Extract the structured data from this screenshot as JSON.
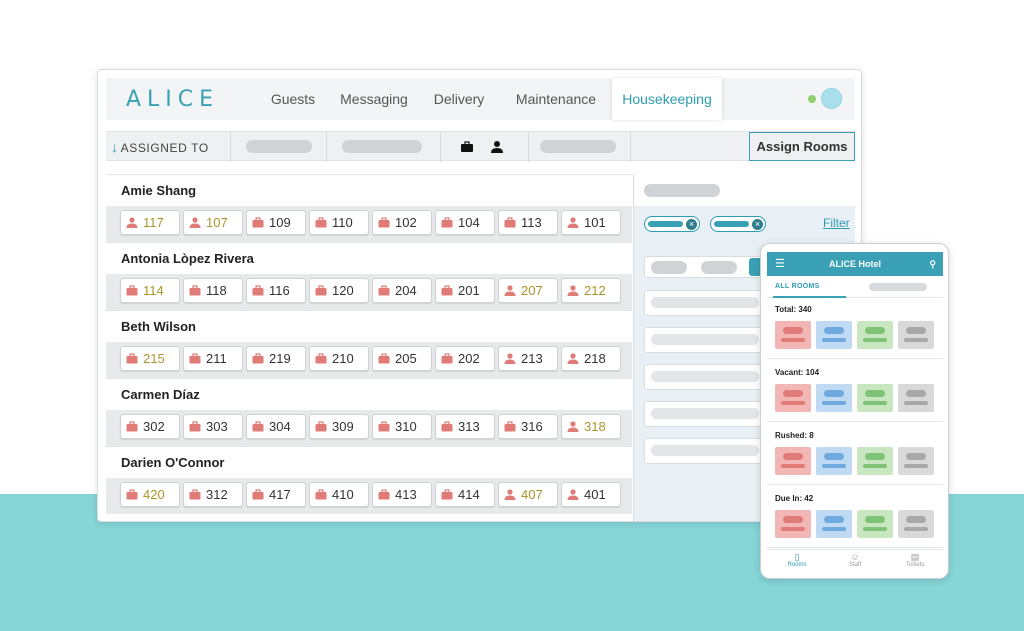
{
  "app": {
    "logo": "ALICE",
    "nav": [
      {
        "label": "Guests",
        "active": false
      },
      {
        "label": "Messaging",
        "active": false
      },
      {
        "label": "Delivery",
        "active": false
      },
      {
        "label": "Maintenance",
        "active": false
      },
      {
        "label": "Housekeeping",
        "active": true
      }
    ],
    "accent_color": "#3aa0b5"
  },
  "toolbar": {
    "assigned_to": "ASSIGNED TO",
    "assign_button": "Assign Rooms"
  },
  "staff": [
    {
      "name": "Amie Shang",
      "rooms": [
        {
          "num": "117",
          "icon": "person-icon",
          "hot": true
        },
        {
          "num": "107",
          "icon": "person-icon",
          "hot": true
        },
        {
          "num": "109",
          "icon": "suitcase-icon",
          "hot": false
        },
        {
          "num": "110",
          "icon": "suitcase-icon",
          "hot": false
        },
        {
          "num": "102",
          "icon": "suitcase-icon",
          "hot": false
        },
        {
          "num": "104",
          "icon": "suitcase-icon",
          "hot": false
        },
        {
          "num": "113",
          "icon": "suitcase-icon",
          "hot": false
        },
        {
          "num": "101",
          "icon": "person-icon",
          "hot": false
        }
      ]
    },
    {
      "name": "Antonia Lòpez Rivera",
      "rooms": [
        {
          "num": "114",
          "icon": "suitcase-icon",
          "hot": true
        },
        {
          "num": "118",
          "icon": "suitcase-icon",
          "hot": false
        },
        {
          "num": "116",
          "icon": "suitcase-icon",
          "hot": false
        },
        {
          "num": "120",
          "icon": "suitcase-icon",
          "hot": false
        },
        {
          "num": "204",
          "icon": "suitcase-icon",
          "hot": false
        },
        {
          "num": "201",
          "icon": "suitcase-icon",
          "hot": false
        },
        {
          "num": "207",
          "icon": "person-icon",
          "hot": true
        },
        {
          "num": "212",
          "icon": "person-icon",
          "hot": true
        }
      ]
    },
    {
      "name": "Beth Wilson",
      "rooms": [
        {
          "num": "215",
          "icon": "suitcase-icon",
          "hot": true
        },
        {
          "num": "211",
          "icon": "suitcase-icon",
          "hot": false
        },
        {
          "num": "219",
          "icon": "suitcase-icon",
          "hot": false
        },
        {
          "num": "210",
          "icon": "suitcase-icon",
          "hot": false
        },
        {
          "num": "205",
          "icon": "suitcase-icon",
          "hot": false
        },
        {
          "num": "202",
          "icon": "suitcase-icon",
          "hot": false
        },
        {
          "num": "213",
          "icon": "person-icon",
          "hot": false
        },
        {
          "num": "218",
          "icon": "person-icon",
          "hot": false
        }
      ]
    },
    {
      "name": "Carmen Díaz",
      "rooms": [
        {
          "num": "302",
          "icon": "suitcase-icon",
          "hot": false
        },
        {
          "num": "303",
          "icon": "suitcase-icon",
          "hot": false
        },
        {
          "num": "304",
          "icon": "suitcase-icon",
          "hot": false
        },
        {
          "num": "309",
          "icon": "suitcase-icon",
          "hot": false
        },
        {
          "num": "310",
          "icon": "suitcase-icon",
          "hot": false
        },
        {
          "num": "313",
          "icon": "suitcase-icon",
          "hot": false
        },
        {
          "num": "316",
          "icon": "suitcase-icon",
          "hot": false
        },
        {
          "num": "318",
          "icon": "person-icon",
          "hot": true
        }
      ]
    },
    {
      "name": "Darien O'Connor",
      "rooms": [
        {
          "num": "420",
          "icon": "suitcase-icon",
          "hot": true
        },
        {
          "num": "312",
          "icon": "suitcase-icon",
          "hot": false
        },
        {
          "num": "417",
          "icon": "suitcase-icon",
          "hot": false
        },
        {
          "num": "410",
          "icon": "suitcase-icon",
          "hot": false
        },
        {
          "num": "413",
          "icon": "suitcase-icon",
          "hot": false
        },
        {
          "num": "414",
          "icon": "suitcase-icon",
          "hot": false
        },
        {
          "num": "407",
          "icon": "person-icon",
          "hot": true
        },
        {
          "num": "401",
          "icon": "person-icon",
          "hot": false
        }
      ]
    }
  ],
  "right_panel": {
    "filter_link": "Filter"
  },
  "phone": {
    "title": "ALICE Hotel",
    "tab_active": "ALL ROOMS",
    "sections": [
      {
        "title": "Total: 340"
      },
      {
        "title": "Vacant: 104"
      },
      {
        "title": "Rushed: 8"
      },
      {
        "title": "Due In: 42"
      }
    ],
    "footer": [
      {
        "label": "Rooms",
        "active": true
      },
      {
        "label": "Staff",
        "active": false
      },
      {
        "label": "Tickets",
        "active": false
      }
    ]
  }
}
